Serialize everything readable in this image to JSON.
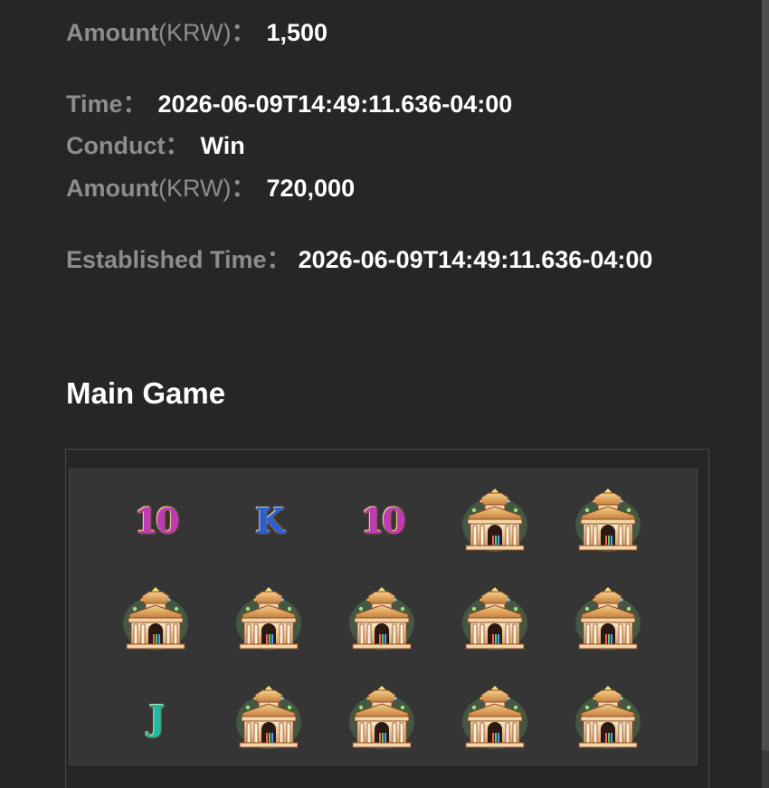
{
  "transaction_rows": [
    {
      "label": "Amount",
      "unit": "(KRW)",
      "colon": "：",
      "value": "1,500"
    },
    {
      "label": "Time",
      "unit": "",
      "colon": "：",
      "value": "2026-06-09T14:49:11.636-04:00"
    },
    {
      "label": "Conduct",
      "unit": "",
      "colon": "：",
      "value": "Win"
    },
    {
      "label": "Amount",
      "unit": "(KRW)",
      "colon": "：",
      "value": "720,000"
    }
  ],
  "established": {
    "label": "Established Time",
    "colon": "：",
    "value": "2026-06-09T14:49:11.636-04:00"
  },
  "main_game": {
    "title": "Main Game",
    "grid": [
      [
        "10",
        "K",
        "10",
        "temple",
        "temple"
      ],
      [
        "temple",
        "temple",
        "temple",
        "temple",
        "temple"
      ],
      [
        "J",
        "temple",
        "temple",
        "temple",
        "temple"
      ]
    ]
  },
  "colors": {
    "background": "#262626",
    "label": "#8d8d8d",
    "value": "#ffffff",
    "grid_bg": "#353535"
  }
}
